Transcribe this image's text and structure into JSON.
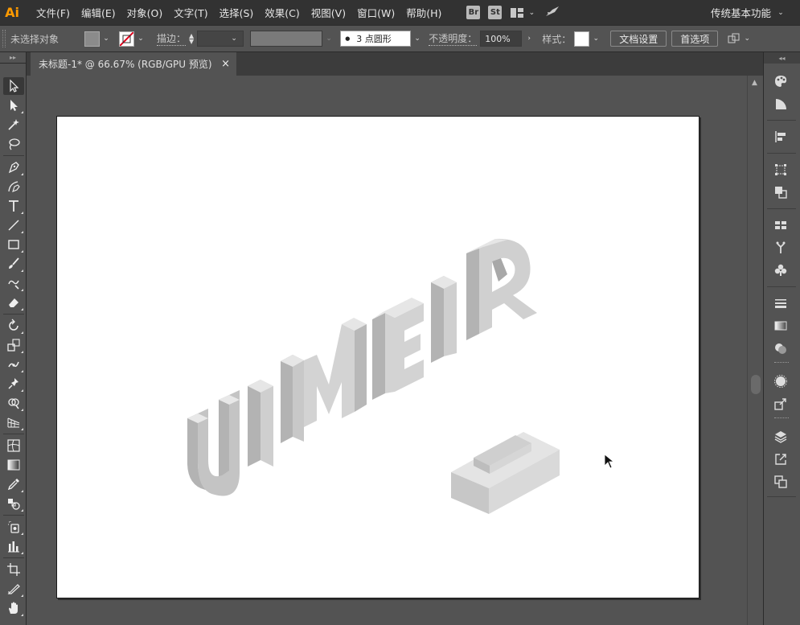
{
  "app": {
    "logo_text": "Ai",
    "accent": "#ff9a00"
  },
  "menu": {
    "items": [
      "文件(F)",
      "编辑(E)",
      "对象(O)",
      "文字(T)",
      "选择(S)",
      "效果(C)",
      "视图(V)",
      "窗口(W)",
      "帮助(H)"
    ],
    "badges": [
      "Br",
      "St"
    ],
    "workspace_label": "传统基本功能"
  },
  "control": {
    "selection_status": "未选择对象",
    "stroke_label": "描边：",
    "brush_label": "3 点圆形",
    "opacity_label": "不透明度：",
    "opacity_value": "100%",
    "style_label": "样式：",
    "doc_setup_button": "文档设置",
    "prefs_button": "首选项"
  },
  "document": {
    "tab_title": "未标题-1* @ 66.67% (RGB/GPU 预览)",
    "tab_close": "×"
  },
  "artwork": {
    "text": "UIMEIR",
    "face_color": "#d3d3d3",
    "side_color": "#b3b3b3",
    "top_color": "#e6e6e6"
  }
}
